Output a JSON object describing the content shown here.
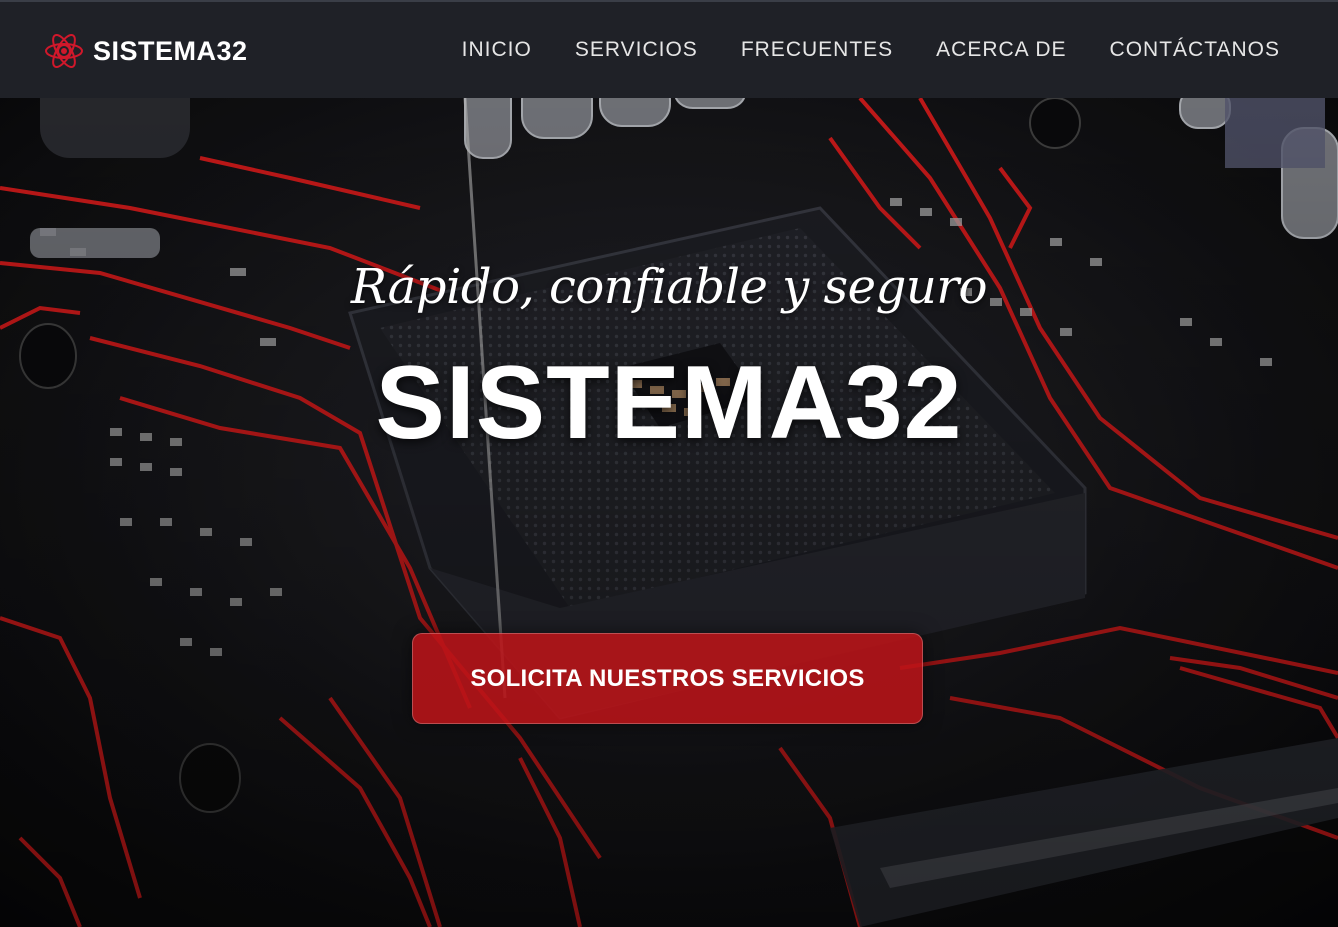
{
  "brand": {
    "name": "SISTEMA32",
    "icon": "atom-icon",
    "accent_color": "#d0182b"
  },
  "nav": {
    "items": [
      {
        "label": "INICIO"
      },
      {
        "label": "SERVICIOS"
      },
      {
        "label": "FRECUENTES"
      },
      {
        "label": "ACERCA DE"
      },
      {
        "label": "CONTÁCTANOS"
      }
    ]
  },
  "hero": {
    "tagline": "Rápido, confiable y seguro",
    "title": "SISTEMA32",
    "cta_label": "SOLICITA NUESTROS SERVICIOS",
    "background": "motherboard-cpu-socket-image",
    "cta_color": "#be1418"
  }
}
